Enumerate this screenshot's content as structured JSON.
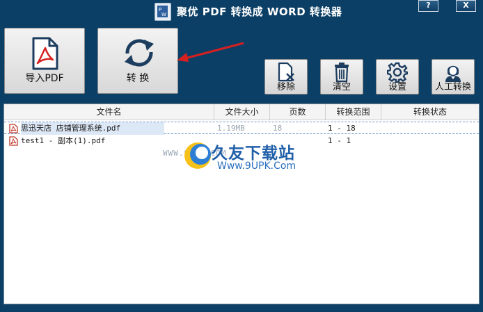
{
  "window": {
    "title": "聚优 PDF 转换成 WORD 转换器",
    "help": "?",
    "close": "X"
  },
  "toolbar": {
    "import_label": "导入PDF",
    "convert_label": "转 换",
    "remove_label": "移除",
    "clear_label": "清空",
    "settings_label": "设置",
    "manual_label": "人工转换"
  },
  "table": {
    "columns": [
      "文件名",
      "文件大小",
      "页数",
      "转换范围",
      "转换状态"
    ],
    "rows": [
      {
        "name": "思迅天店 店铺管理系统.pdf",
        "size": "1.19MB",
        "pages": "18",
        "range": "1 - 18",
        "status": ""
      },
      {
        "name": "test1 - 副本(1).pdf",
        "size": "",
        "pages": "",
        "range": "1 - 1",
        "status": ""
      }
    ]
  },
  "watermark": {
    "prefix": "WWW.9UPK.COM",
    "brand": "久友下载站",
    "url": "Www.9UPK.Com"
  },
  "colors": {
    "background": "#0b3f66",
    "accent_red": "#d62020",
    "pdf_red": "#c0392b"
  }
}
